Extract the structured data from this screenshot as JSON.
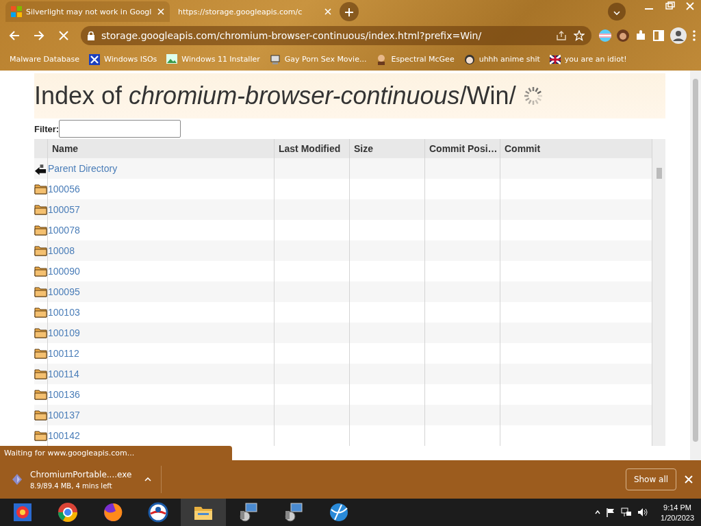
{
  "tabs": [
    {
      "title": "Silverlight may not work in Googl",
      "selected": true
    },
    {
      "title": "https://storage.googleapis.com/c",
      "selected": false
    }
  ],
  "toolbar": {
    "loading": true,
    "address": "storage.googleapis.com/chromium-browser-continuous/index.html?prefix=Win/"
  },
  "bookmarks": [
    {
      "label": "Malware Database"
    },
    {
      "label": "Windows ISOs"
    },
    {
      "label": "Windows 11 Installer"
    },
    {
      "label": "Gay Porn Sex Movie..."
    },
    {
      "label": "Espectral McGee"
    },
    {
      "label": "uhhh anime shit"
    },
    {
      "label": "you are an idiot!"
    }
  ],
  "page": {
    "heading": "Index of *chromium-browser-continuous*/Win/",
    "loading": true,
    "filter_label": "Filter:",
    "columns": [
      "Name",
      "Last Modified",
      "Size",
      "Commit Posi…",
      "Commit"
    ],
    "rows": [
      {
        "kind": "parent",
        "name": "Parent Directory"
      },
      {
        "kind": "folder",
        "name": "100056"
      },
      {
        "kind": "folder",
        "name": "100057"
      },
      {
        "kind": "folder",
        "name": "100078"
      },
      {
        "kind": "folder",
        "name": "10008"
      },
      {
        "kind": "folder",
        "name": "100090"
      },
      {
        "kind": "folder",
        "name": "100095"
      },
      {
        "kind": "folder",
        "name": "100103"
      },
      {
        "kind": "folder",
        "name": "100109"
      },
      {
        "kind": "folder",
        "name": "100112"
      },
      {
        "kind": "folder",
        "name": "100114"
      },
      {
        "kind": "folder",
        "name": "100136"
      },
      {
        "kind": "folder",
        "name": "100137"
      },
      {
        "kind": "folder",
        "name": "100142"
      }
    ]
  },
  "status_bubble": "Waiting for www.googleapis.com...",
  "download": {
    "file": "ChromiumPortable....exe",
    "progress": "8.9/89.4 MB, 4 mins left",
    "show_all": "Show all"
  },
  "taskbar": {
    "time": "9:14 PM",
    "date": "1/20/2023"
  }
}
